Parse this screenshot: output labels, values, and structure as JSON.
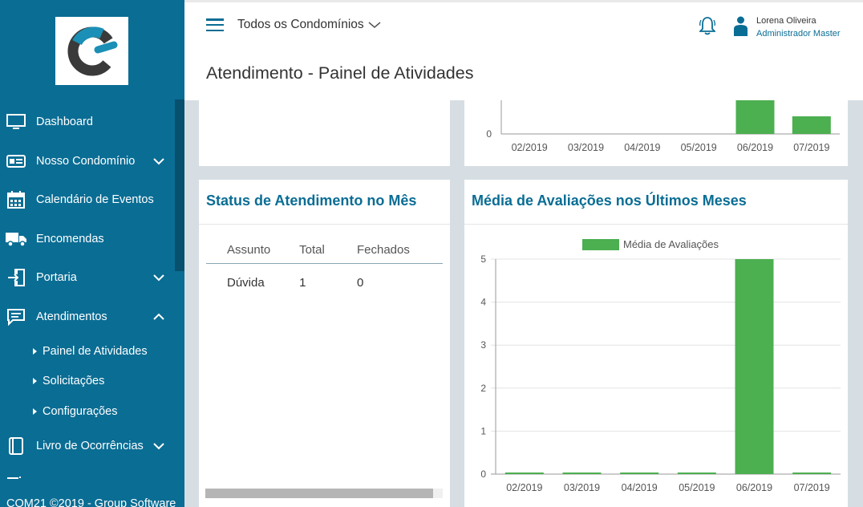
{
  "sidebar": {
    "items": [
      {
        "label": "Dashboard",
        "icon": "monitor-icon"
      },
      {
        "label": "Nosso Condomínio",
        "icon": "id-card-icon",
        "chevron": "down"
      },
      {
        "label": "Calendário de Eventos",
        "icon": "calendar-icon"
      },
      {
        "label": "Encomendas",
        "icon": "truck-icon"
      },
      {
        "label": "Portaria",
        "icon": "door-enter-icon",
        "chevron": "down"
      },
      {
        "label": "Atendimentos",
        "icon": "chat-icon",
        "chevron": "up"
      }
    ],
    "subitems": [
      {
        "label": "Painel de Atividades"
      },
      {
        "label": "Solicitações"
      },
      {
        "label": "Configurações"
      }
    ],
    "after_items": [
      {
        "label": "Livro de Ocorrências",
        "icon": "book-icon",
        "chevron": "down"
      }
    ],
    "footer": "COM21 ©2019 - Group Software"
  },
  "header": {
    "condominio_select": "Todos os Condomínios",
    "user_name": "Lorena Oliveira",
    "user_role": "Administrador Master",
    "page_title": "Atendimento - Painel de Atividades"
  },
  "status_card": {
    "title": "Status de Atendimento no Mês",
    "columns": [
      "Assunto",
      "Total",
      "Fechados"
    ],
    "rows": [
      [
        "Dúvida",
        "1",
        "0"
      ]
    ]
  },
  "rating_card": {
    "title": "Média de Avaliações nos Últimos Meses"
  },
  "colors": {
    "primary": "#0a6d94",
    "bar": "#4caf50"
  },
  "chart_data": [
    {
      "type": "bar",
      "categories": [
        "02/2019",
        "03/2019",
        "04/2019",
        "05/2019",
        "06/2019",
        "07/2019"
      ],
      "values": [
        0,
        0,
        0,
        0,
        2,
        1
      ],
      "ytick_visible": [
        "0"
      ],
      "note": "partially scrolled out of view"
    },
    {
      "type": "bar",
      "title": "Média de Avaliações nos Últimos Meses",
      "legend": "Média de Avaliações",
      "categories": [
        "02/2019",
        "03/2019",
        "04/2019",
        "05/2019",
        "06/2019",
        "07/2019"
      ],
      "values": [
        0,
        0,
        0,
        0,
        5,
        0
      ],
      "yticks": [
        "0",
        "1",
        "2",
        "3",
        "4",
        "5"
      ],
      "ylim": [
        0,
        5
      ],
      "grid": true,
      "legend_position": "top"
    }
  ]
}
